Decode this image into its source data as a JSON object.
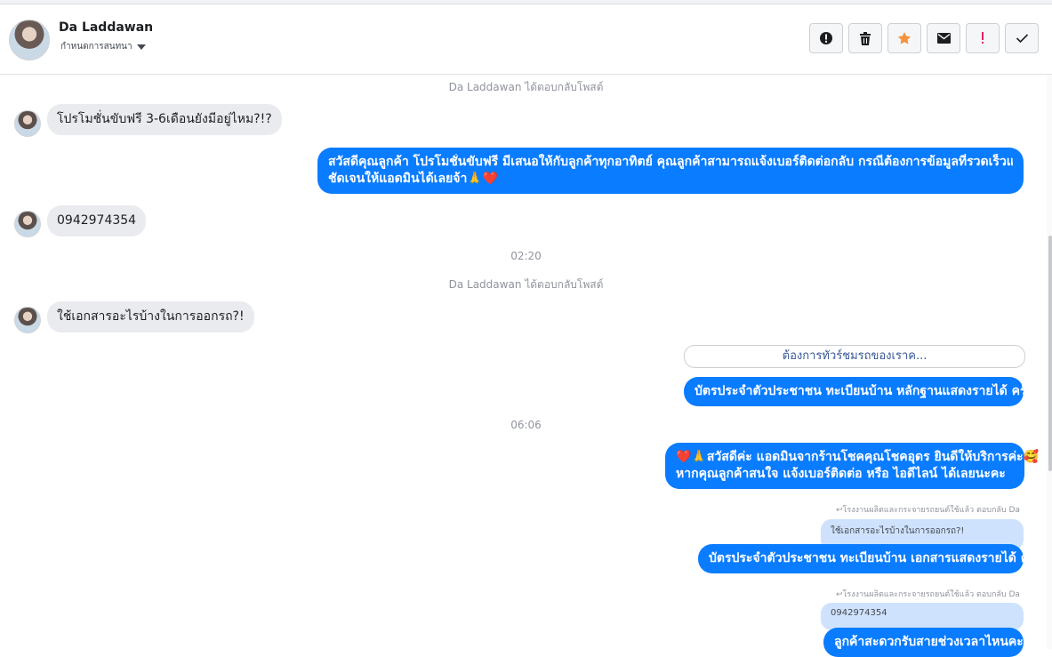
{
  "header": {
    "name": "Da Laddawan",
    "assign_label": "กำหนดการสนทนา",
    "actions": [
      {
        "icon": "alert-circle-icon"
      },
      {
        "icon": "trash-icon"
      },
      {
        "icon": "star-icon",
        "color": "#f7923b"
      },
      {
        "icon": "mail-icon"
      },
      {
        "icon": "exclamation-icon",
        "color": "#e0245e"
      },
      {
        "icon": "check-icon"
      }
    ]
  },
  "conversation": {
    "sys_1": "Da Laddawan ได้ตอบกลับโพสต์",
    "in_1": "โปรโมชั่นขับฟรี 3-6เดือนยังมีอยู่ไหม?!?",
    "out_1_line1": "สวัสดีคุณลูกค้า โปรโมชั่นขับฟรี มีเสนอให้กับลูกค้าทุกอาทิตย์ คุณลูกค้าสามารถแจ้งเบอร์ติดต่อกลับ กรณีต้องการข้อมูลที่รวดเร็วและ",
    "out_1_line2": "ชัดเจนให้แอดมินได้เลยจ้า🙏❤️",
    "in_2": "0942974354",
    "time_1": "02:20",
    "sys_2": "Da Laddawan ได้ตอบกลับโพสต์",
    "in_3": "ใช้เอกสารอะไรบ้างในการออกรถ?!",
    "quick_reply": "ต้องการทัวร์ชมรถของเราค...",
    "out_2": "บัตรประจำตัวประชาชน ทะเบียนบ้าน หลักฐานแสดงรายได้ ครับ",
    "time_2": "06:06",
    "out_3_line1": "❤️🙏สวัสดีค่ะ แอดมินจากร้านโชคคุณโชคอุดร ยินดีให้บริการค่ะ🥰",
    "out_3_line2": "หากคุณลูกค้าสนใจ แจ้งเบอร์ติดต่อ หรือ ไอดีไลน์ ได้เลยนะคะ",
    "reply_note_1": "↩โรงงานผลิตและกระจายรถยนต์ใช้แล้ว ตอบกลับ Da",
    "quoted_1": "ใช้เอกสารอะไรบ้างในการออกรถ?!",
    "out_4": "บัตรประจำตัวประชาชน ทะเบียนบ้าน เอกสารแสดงรายได้ ค่ะ",
    "reply_note_2": "↩โรงงานผลิตและกระจายรถยนต์ใช้แล้ว ตอบกลับ Da",
    "quoted_2": "0942974354",
    "out_5": "ลูกค้าสะดวกรับสายช่วงเวลาไหนคะ"
  },
  "colors": {
    "outgoing_bubble": "#0a7cff",
    "incoming_bubble": "#e9ebee",
    "quoted_bubble": "#cfe2fd"
  }
}
